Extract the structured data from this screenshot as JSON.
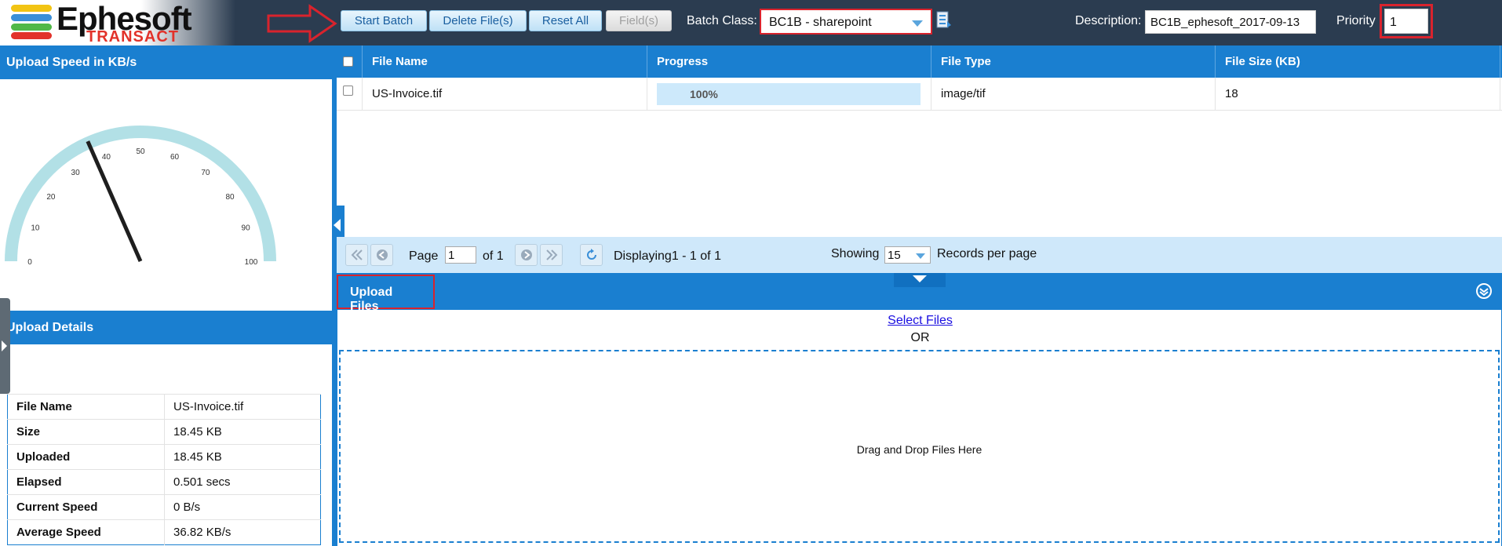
{
  "app": {
    "logo_name": "Ephesoft",
    "logo_sub": "TRANSACT"
  },
  "toolbar": {
    "start_batch": "Start Batch",
    "delete_files": "Delete File(s)",
    "reset_all": "Reset All",
    "fields": "Field(s)",
    "batch_class_label": "Batch Class:",
    "batch_class_value": "BC1B - sharepoint",
    "description_label": "Description:",
    "description_value": "BC1B_ephesoft_2017-09-13",
    "priority_label": "Priority",
    "priority_value": "1"
  },
  "speed_panel": {
    "title": "Upload Speed in KB/s",
    "gauge": {
      "min": 0,
      "max": 100,
      "value": 36.82,
      "ticks": [
        "0",
        "10",
        "20",
        "30",
        "40",
        "50",
        "60",
        "70",
        "80",
        "90",
        "100"
      ],
      "track_color": "#b2e0e6"
    }
  },
  "details_panel": {
    "title": "Upload Details",
    "rows": [
      {
        "key": "File Name",
        "value": "US-Invoice.tif"
      },
      {
        "key": "Size",
        "value": "18.45 KB"
      },
      {
        "key": "Uploaded",
        "value": "18.45 KB"
      },
      {
        "key": "Elapsed",
        "value": "0.501 secs"
      },
      {
        "key": "Current Speed",
        "value": "0 B/s"
      },
      {
        "key": "Average Speed",
        "value": "36.82 KB/s"
      }
    ]
  },
  "grid": {
    "columns": [
      "File Name",
      "Progress",
      "File Type",
      "File Size (KB)"
    ],
    "rows": [
      {
        "file_name": "US-Invoice.tif",
        "progress": "100%",
        "progress_value": 1.0,
        "file_type": "image/tif",
        "file_size": "18"
      }
    ]
  },
  "pager": {
    "page_label": "Page",
    "page_value": "1",
    "of_label": "of 1",
    "displaying": "Displaying1 - 1 of 1",
    "showing_label": "Showing",
    "per_page_value": "15",
    "records_label": "Records per page"
  },
  "upload": {
    "title": "Upload Files",
    "select_files": "Select Files",
    "or": "OR",
    "drop_text": "Drag and Drop Files Here"
  },
  "colors": {
    "header_bg": "#2b3c50",
    "accent": "#1a7fd0",
    "highlight": "#d9232d"
  }
}
